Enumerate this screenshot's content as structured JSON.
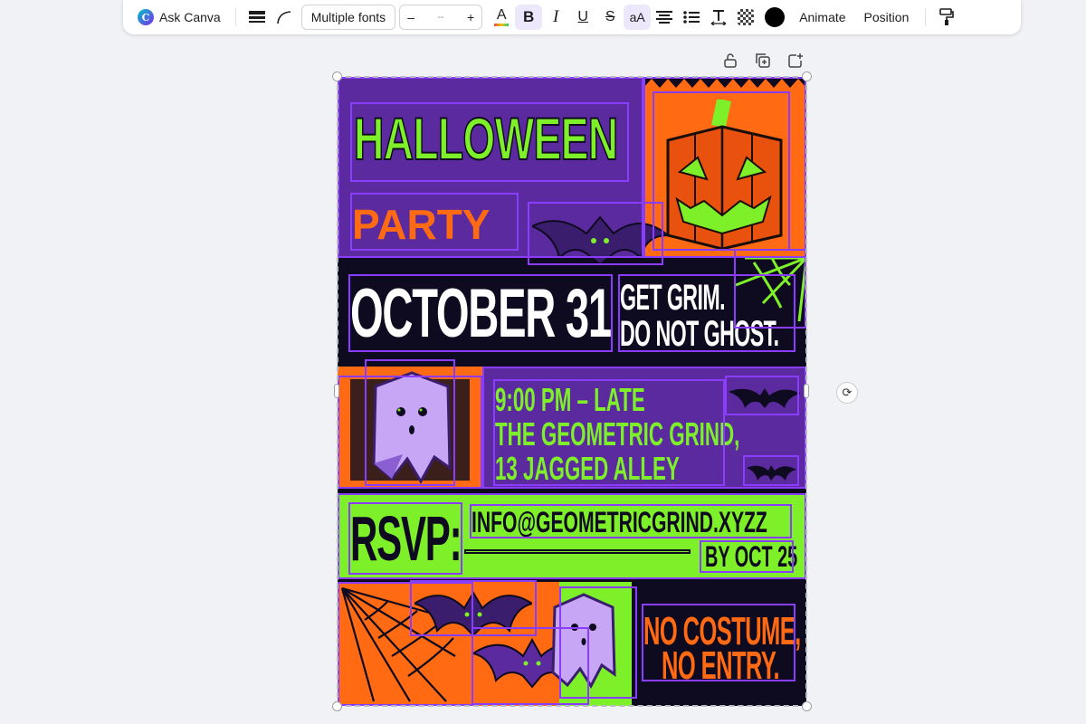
{
  "toolbar": {
    "ask_canva": "Ask Canva",
    "font_name": "Multiple fonts",
    "font_size_decrease": "–",
    "font_size_value": "--",
    "font_size_increase": "+",
    "text_color_letter": "A",
    "bold_label": "B",
    "italic_label": "I",
    "underline_label": "U",
    "strike_label": "S",
    "case_label": "aA",
    "animate": "Animate",
    "position": "Position",
    "text_color_accent": "#e74c3c"
  },
  "poster": {
    "title_line1": "HALLOWEEN",
    "title_line2": "PARTY",
    "date": "OCTOBER 31",
    "tagline_line1": "GET GRIM.",
    "tagline_line2": "DO NOT GHOST.",
    "details_line1": "9:00 PM – LATE",
    "details_line2": "THE GEOMETRIC GRIND,",
    "details_line3": "13 JAGGED ALLEY",
    "rsvp_label": "RSVP:",
    "rsvp_email": "INFO@GEOMETRICGRIND.XYZZ",
    "rsvp_deadline": "BY OCT 25",
    "footer_line1": "NO COSTUME,",
    "footer_line2": "NO ENTRY.",
    "colors": {
      "purple": "#5b2a9e",
      "orange": "#ff6a13",
      "green": "#7ef02a",
      "dark": "#0e0a1f",
      "ghost": "#c7a6f5",
      "selection": "#8b3dff"
    }
  }
}
